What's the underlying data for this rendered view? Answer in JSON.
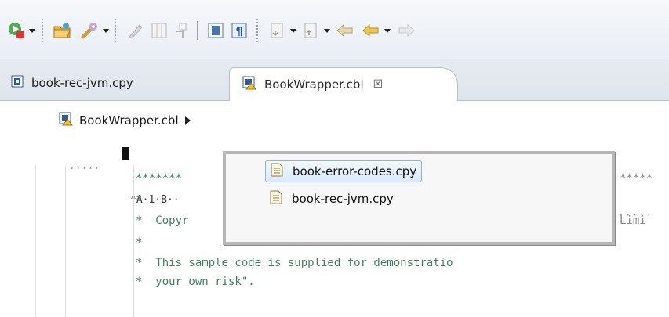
{
  "toolbar": {
    "items": [
      {
        "name": "run-icon"
      },
      {
        "name": "open-folder-icon"
      },
      {
        "name": "wrench-icon"
      },
      {
        "name": "pencil-icon"
      },
      {
        "name": "columns-icon"
      },
      {
        "name": "pin-icon"
      },
      {
        "name": "block-icon"
      },
      {
        "name": "pilcrow-icon"
      },
      {
        "name": "next-annotation-icon"
      },
      {
        "name": "prev-annotation-icon"
      },
      {
        "name": "back-icon"
      },
      {
        "name": "forward-icon"
      }
    ]
  },
  "tabs": [
    {
      "label": "book-rec-jvm.cpy",
      "active": false
    },
    {
      "label": "BookWrapper.cbl",
      "active": true,
      "close": "☒"
    }
  ],
  "breadcrumb": {
    "label": "BookWrapper.cbl"
  },
  "ruler": {
    "prefix": "·····",
    "text": "*A·1·B··",
    "tail": "·····"
  },
  "code": {
    "lines": [
      {
        "text": "*******",
        "tail": "*****"
      },
      {
        "text": "*"
      },
      {
        "text": "*  Copyr",
        "tail": "Limi"
      },
      {
        "text": "*"
      },
      {
        "text": "*  This sample code is supplied for demonstratio"
      },
      {
        "text": "*  your own risk\"."
      }
    ]
  },
  "popup": {
    "items": [
      {
        "label": "book-error-codes.cpy",
        "selected": true
      },
      {
        "label": "book-rec-jvm.cpy",
        "selected": false
      }
    ]
  },
  "colors": {
    "comment": "#3f7f5f",
    "selection_border": "#8db3e6"
  }
}
